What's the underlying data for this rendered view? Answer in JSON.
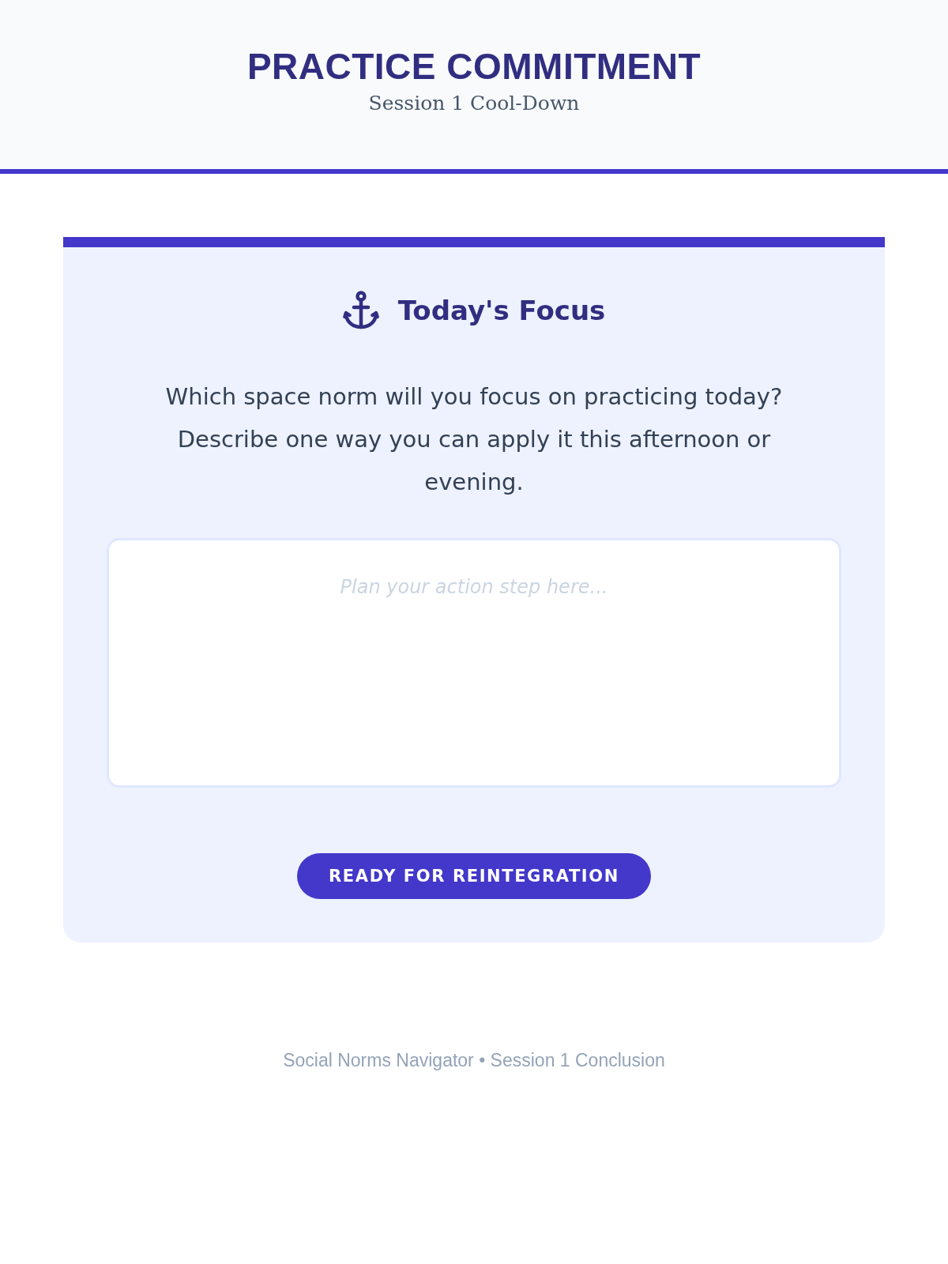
{
  "header": {
    "title": "PRACTICE COMMITMENT",
    "subtitle": "Session 1 Cool-Down"
  },
  "card": {
    "heading": "Today's Focus",
    "prompt": "Which space norm will you focus on practicing today? Describe one way you can apply it this afternoon or evening.",
    "answer": {
      "placeholder": "Plan your action step here..."
    },
    "button": "READY FOR REINTEGRATION"
  },
  "footer": {
    "text": "Social Norms Navigator • Session 1 Conclusion"
  }
}
